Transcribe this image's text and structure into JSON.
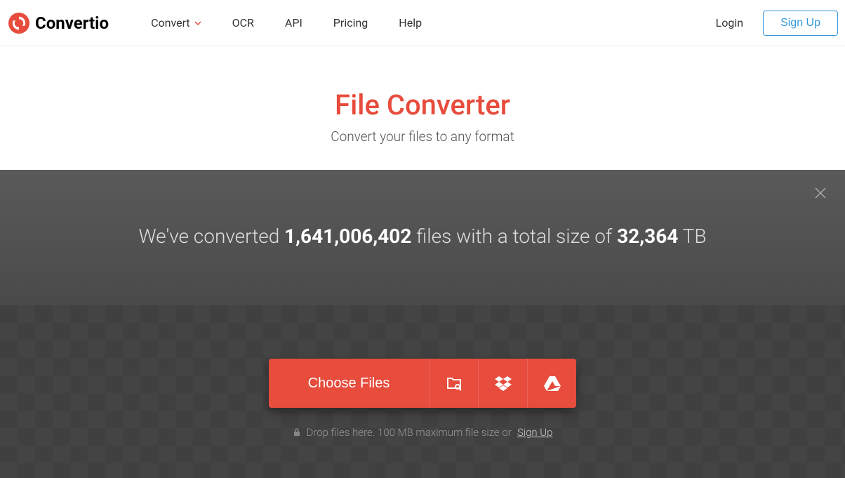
{
  "brand": "Convertio",
  "nav": {
    "convert": "Convert",
    "ocr": "OCR",
    "api": "API",
    "pricing": "Pricing",
    "help": "Help"
  },
  "auth": {
    "login": "Login",
    "signup": "Sign Up"
  },
  "hero": {
    "title": "File Converter",
    "subtitle": "Convert your files to any format"
  },
  "stats": {
    "prefix": "We've converted ",
    "file_count": "1,641,006,402",
    "mid": " files with a total size of ",
    "total_size": "32,364",
    "unit": " TB"
  },
  "upload": {
    "choose": "Choose Files",
    "hint_pre": "Drop files here. 100 MB maximum file size or ",
    "hint_link": "Sign Up"
  },
  "colors": {
    "accent": "#e74c3c",
    "link": "#3498db"
  }
}
